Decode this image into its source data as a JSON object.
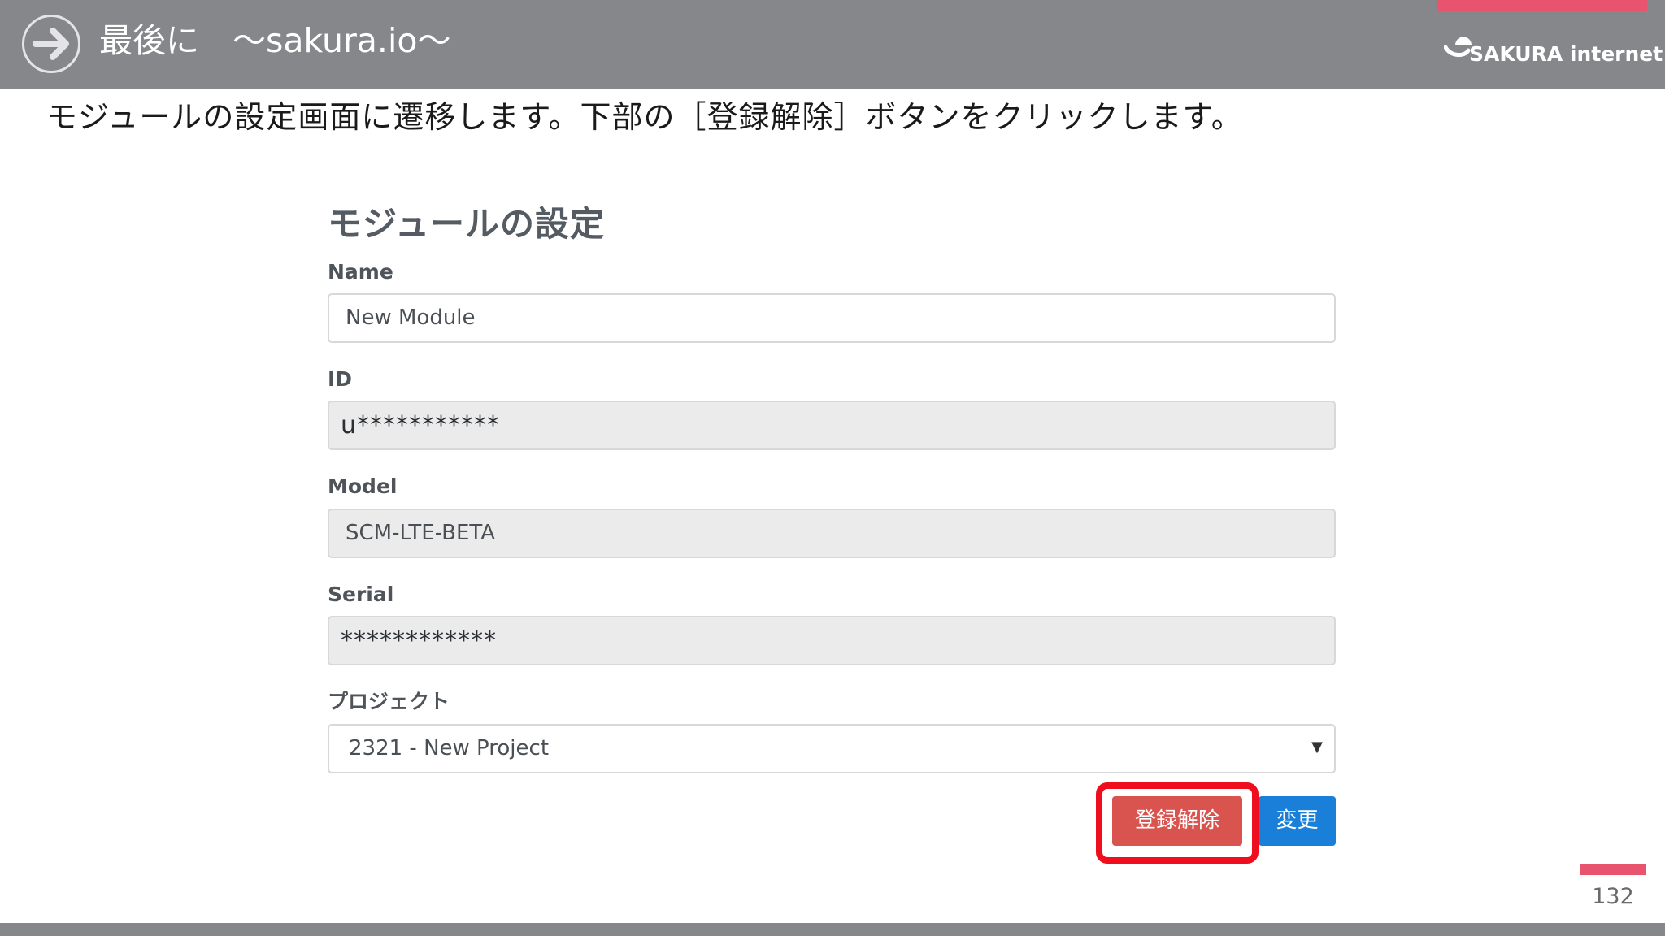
{
  "header": {
    "title": "最後に　～sakura.io～",
    "logo_text": "SAKURA internet"
  },
  "instruction": "モジュールの設定画面に遷移します。下部の［登録解除］ボタンをクリックします。",
  "form": {
    "title": "モジュールの設定",
    "name": {
      "label": "Name",
      "value": "New Module"
    },
    "id": {
      "label": "ID",
      "value": "u***********"
    },
    "model": {
      "label": "Model",
      "value": "SCM-LTE-BETA"
    },
    "serial": {
      "label": "Serial",
      "value": "************"
    },
    "project": {
      "label": "プロジェクト",
      "selected": "2321 - New Project"
    },
    "buttons": {
      "unregister": "登録解除",
      "change": "変更"
    }
  },
  "page_number": "132",
  "colors": {
    "header_bg": "#86878b",
    "accent_pink": "#e8546e",
    "danger": "#d9534f",
    "primary": "#1a7fd9",
    "highlight": "#ee0e1e"
  }
}
